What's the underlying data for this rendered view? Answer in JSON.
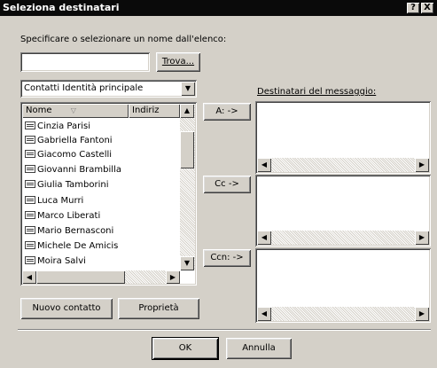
{
  "window": {
    "title": "Seleziona destinatari",
    "help_btn": "?",
    "close_btn": "X"
  },
  "prompt": "Specificare o selezionare un nome dall'elenco:",
  "search": {
    "value": "",
    "find_button": "Trova..."
  },
  "address_book": {
    "selected": "Contatti Identità principale"
  },
  "list": {
    "columns": [
      "Nome",
      "Indiriz"
    ],
    "items": [
      "Cinzia Parisi",
      "Gabriella Fantoni",
      "Giacomo Castelli",
      "Giovanni Brambilla",
      "Giulia Tamborini",
      "Luca Murri",
      "Marco Liberati",
      "Mario Bernasconi",
      "Michele De Amicis",
      "Moira Salvi"
    ]
  },
  "recipients": {
    "label": "Destinatari del messaggio:",
    "to_button": "A: ->",
    "cc_button": "Cc ->",
    "bcc_button": "Ccn: ->"
  },
  "buttons": {
    "new_contact": "Nuovo contatto",
    "properties": "Proprietà",
    "ok": "OK",
    "cancel": "Annulla"
  }
}
